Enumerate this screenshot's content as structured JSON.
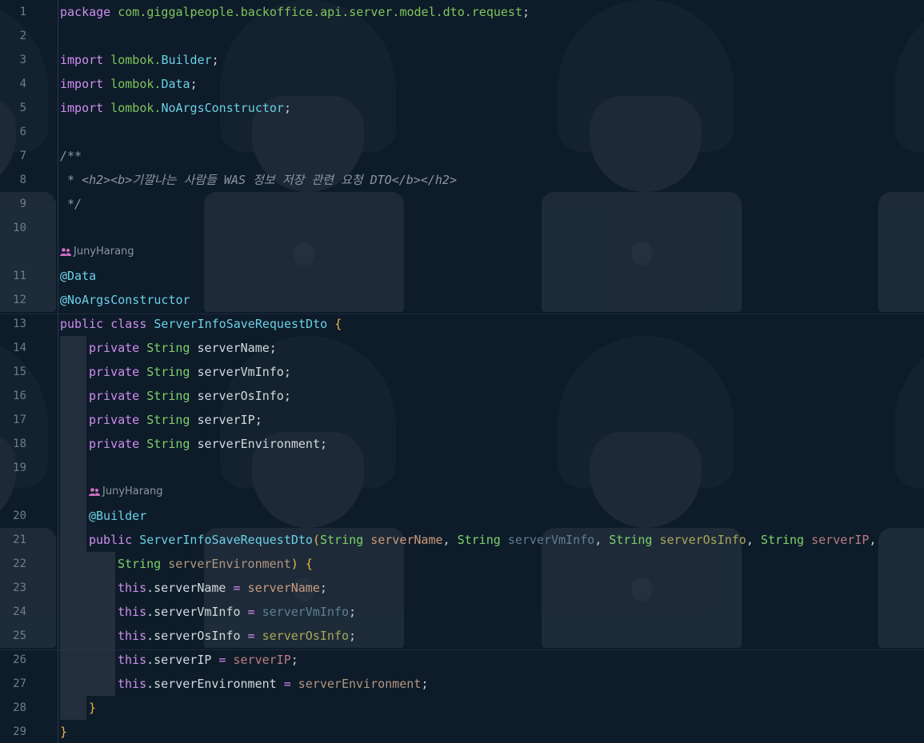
{
  "editor": {
    "line_numbers": [
      "1",
      "2",
      "3",
      "4",
      "5",
      "6",
      "7",
      "8",
      "9",
      "10",
      "11",
      "12",
      "13",
      "14",
      "15",
      "16",
      "17",
      "18",
      "19",
      "20",
      "21",
      "22",
      "23",
      "24",
      "25",
      "26",
      "27",
      "28",
      "29"
    ],
    "hints": {
      "author1": "JunyHarang",
      "author2": "JunyHarang"
    },
    "code": {
      "l1_kw": "package",
      "l1_pkg": "com.giggalpeople.backoffice.api.server.model.dto.request",
      "l1_end": ";",
      "l3_kw": "import",
      "l3_pkg": "lombok.",
      "l3_cls": "Builder",
      "l3_end": ";",
      "l4_kw": "import",
      "l4_pkg": "lombok.",
      "l4_cls": "Data",
      "l4_end": ";",
      "l5_kw": "import",
      "l5_pkg": "lombok.",
      "l5_cls": "NoArgsConstructor",
      "l5_end": ";",
      "l7": "/**",
      "l8": " * <h2><b>기깔나는 사람들 WAS 정보 저장 관련 요청 DTO</b></h2>",
      "l9": " */",
      "l11": "@Data",
      "l12": "@NoArgsConstructor",
      "l13_kw": "public class",
      "l13_cls": "ServerInfoSaveRequestDto",
      "l13_brace": "{",
      "fields": [
        {
          "kw": "private",
          "type": "String",
          "name": "serverName;"
        },
        {
          "kw": "private",
          "type": "String",
          "name": "serverVmInfo;"
        },
        {
          "kw": "private",
          "type": "String",
          "name": "serverOsInfo;"
        },
        {
          "kw": "private",
          "type": "String",
          "name": "serverIP;"
        },
        {
          "kw": "private",
          "type": "String",
          "name": "serverEnvironment;"
        }
      ],
      "l20": "@Builder",
      "l21_kw": "public",
      "l21_cls": "ServerInfoSaveRequestDto",
      "l21_paren": "(",
      "l21_t1": "String",
      "l21_p1": "serverName",
      "l21_t2": "String",
      "l21_p2": "serverVmInfo",
      "l21_t3": "String",
      "l21_p3": "serverOsInfo",
      "l21_t4": "String",
      "l21_p4": "serverIP",
      "comma": ",",
      "l22_t5": "String",
      "l22_p5": "serverEnvironment",
      "l22_close": ")",
      "l22_brace": "{",
      "assigns": [
        {
          "this": "this",
          "field": ".serverName",
          "eq": " = ",
          "val": "serverName",
          "end": ";"
        },
        {
          "this": "this",
          "field": ".serverVmInfo",
          "eq": " = ",
          "val": "serverVmInfo",
          "end": ";"
        },
        {
          "this": "this",
          "field": ".serverOsInfo",
          "eq": " = ",
          "val": "serverOsInfo",
          "end": ";"
        },
        {
          "this": "this",
          "field": ".serverIP",
          "eq": " = ",
          "val": "serverIP",
          "end": ";"
        },
        {
          "this": "this",
          "field": ".serverEnvironment",
          "eq": " = ",
          "val": "serverEnvironment",
          "end": ";"
        }
      ],
      "l28": "}",
      "l29": "}"
    },
    "colors": {
      "background": "#0e1b29",
      "keyword": "#cf8ef0",
      "type": "#7cd36b",
      "annotation": "#6ad0e6",
      "brace": "#e8b84a",
      "author_icon": "#d26fc7"
    },
    "icons": {
      "author": "people-icon"
    }
  }
}
